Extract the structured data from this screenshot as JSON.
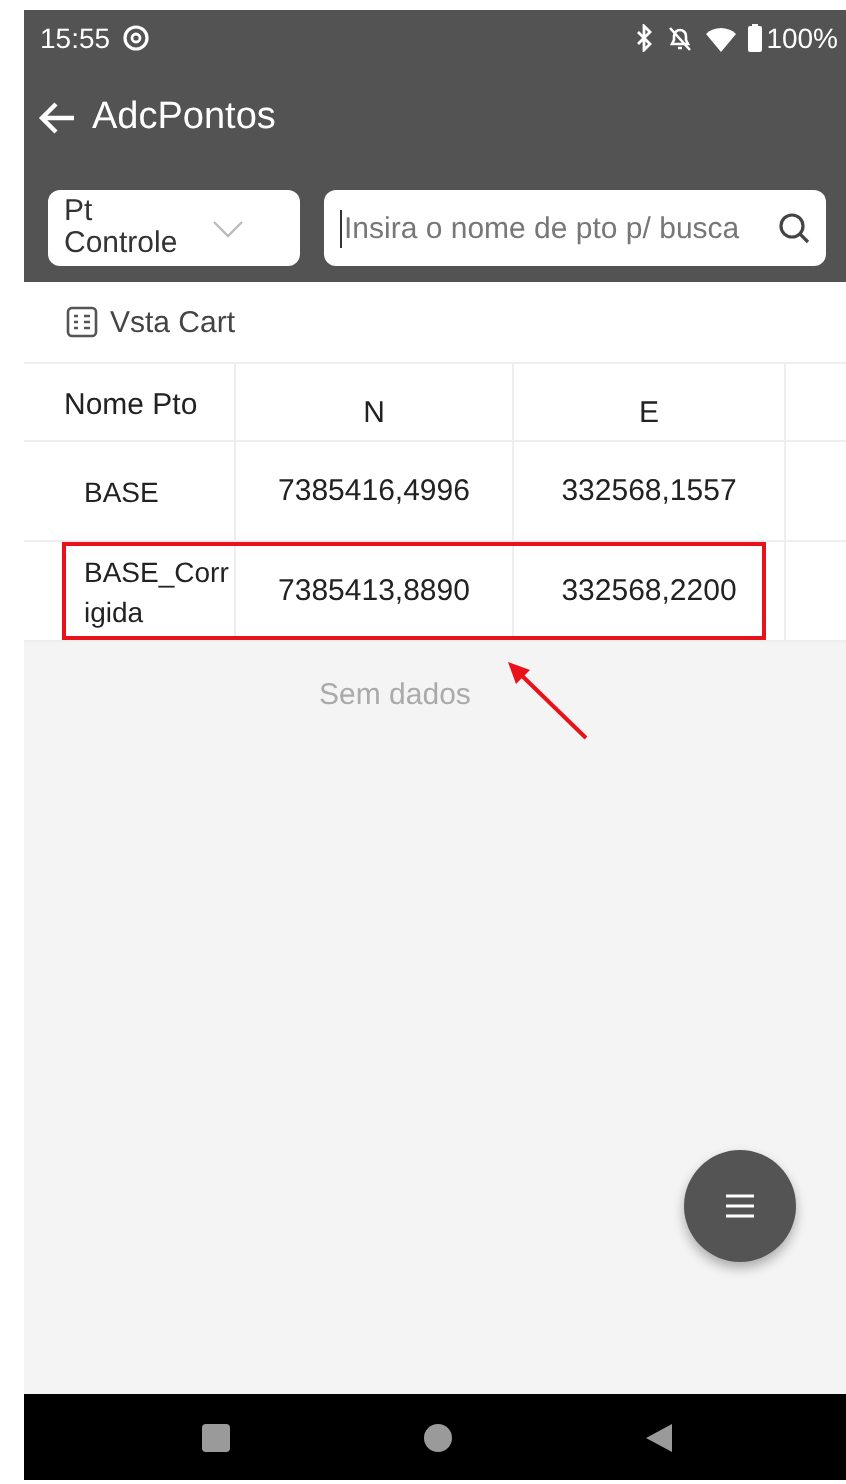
{
  "status_bar": {
    "time": "15:55",
    "battery": "100%"
  },
  "header": {
    "title": "AdcPontos",
    "filter": {
      "value": "Pt Controle"
    },
    "search": {
      "placeholder": "Insira o nome de pto p/ busca"
    }
  },
  "view_toggle": {
    "label": "Vsta Cart"
  },
  "table": {
    "columns": [
      "Nome Pto",
      "N",
      "E"
    ],
    "rows": [
      {
        "cells": [
          "BASE",
          "7385416,4996",
          "332568,1557"
        ],
        "highlighted": false
      },
      {
        "cells": [
          "BASE_Corrigida",
          "7385413,8890",
          "332568,2200"
        ],
        "highlighted": true
      }
    ]
  },
  "empty_message": "Sem dados"
}
